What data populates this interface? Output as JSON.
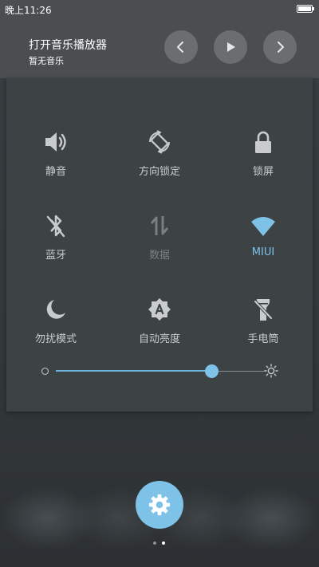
{
  "status_bar": {
    "time": "晚上11:26"
  },
  "music": {
    "title": "打开音乐播放器",
    "subtitle": "暂无音乐"
  },
  "tiles": [
    {
      "label": "静音",
      "icon": "volume-icon",
      "active": false
    },
    {
      "label": "方向锁定",
      "icon": "rotation-lock-icon",
      "active": false
    },
    {
      "label": "锁屏",
      "icon": "lock-icon",
      "active": false
    },
    {
      "label": "蓝牙",
      "icon": "bluetooth-off-icon",
      "active": false
    },
    {
      "label": "数据",
      "icon": "mobile-data-icon",
      "active": false,
      "disabled": true
    },
    {
      "label": "MIUI",
      "icon": "wifi-icon",
      "active": true
    },
    {
      "label": "勿扰模式",
      "icon": "moon-icon",
      "active": false
    },
    {
      "label": "自动亮度",
      "icon": "auto-brightness-icon",
      "active": false
    },
    {
      "label": "手电筒",
      "icon": "flashlight-off-icon",
      "active": false
    }
  ],
  "brightness": {
    "level": 0.745
  },
  "pager": {
    "pages": 2,
    "current": 2
  },
  "colors": {
    "accent": "#7fc2e8",
    "tile_icon": "#c9cccd",
    "tile_disabled": "#7b7f81"
  }
}
